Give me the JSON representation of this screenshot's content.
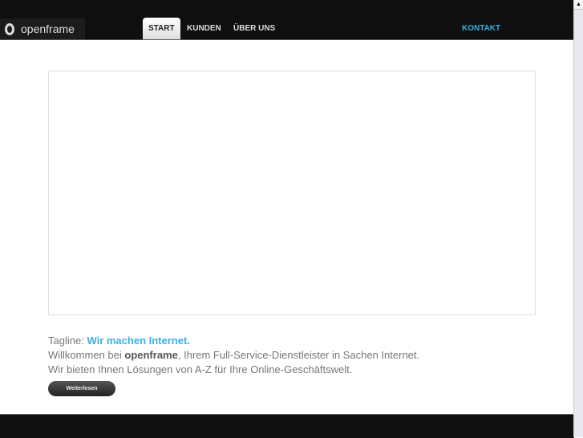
{
  "brand": "openframe",
  "nav": [
    {
      "label": "START"
    },
    {
      "label": "KUNDEN"
    },
    {
      "label": "ÜBER UNS"
    },
    {
      "label": "KONTAKT"
    }
  ],
  "content": {
    "tagline_label": "Tagline:",
    "tagline": "Wir machen Internet.",
    "line1_pre": "Willkommen bei",
    "line1_bold": "openframe",
    "line1_post": ", Ihrem Full-Service-Dienstleister in Sachen Internet.",
    "line2": "Wir bieten Ihnen Lösungen von A-Z für Ihre Online-Geschäftswelt.",
    "button": "Weiterlesen"
  }
}
